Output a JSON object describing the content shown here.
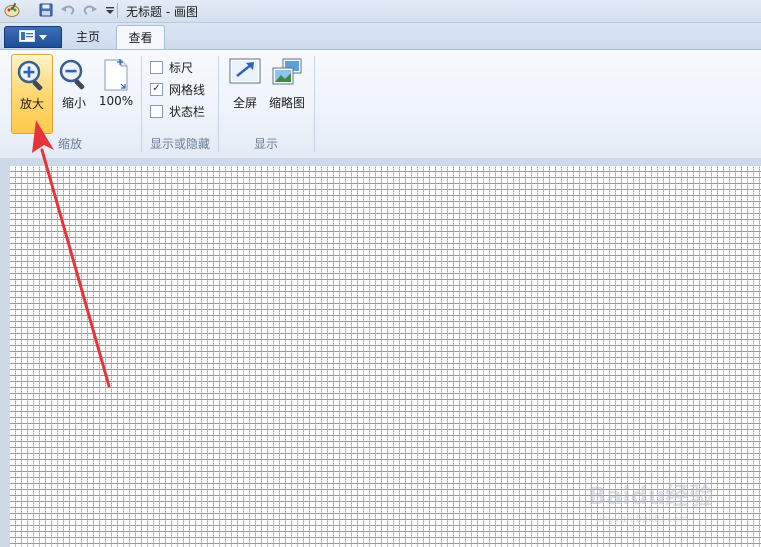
{
  "window": {
    "title": "无标题 - 画图"
  },
  "quick_access": {
    "icons": [
      "paint-app-icon",
      "save-icon",
      "undo-icon",
      "redo-icon",
      "customize-dropdown-icon"
    ]
  },
  "tabs": [
    {
      "label": "主页",
      "active": false
    },
    {
      "label": "查看",
      "active": true
    }
  ],
  "ribbon": {
    "zoom_group": {
      "label": "缩放",
      "zoom_in": "放大",
      "zoom_out": "缩小",
      "zoom_100": "100%"
    },
    "show_hide_group": {
      "label": "显示或隐藏",
      "ruler": {
        "label": "标尺",
        "checked": false
      },
      "gridlines": {
        "label": "网格线",
        "checked": true
      },
      "statusbar": {
        "label": "状态栏",
        "checked": false
      }
    },
    "display_group": {
      "label": "显示",
      "fullscreen": "全屏",
      "thumbnail": "缩略图"
    }
  },
  "colors": {
    "accent_active": "#ffd872",
    "app_menu": "#2a5ca8",
    "arrow": "#e8333a"
  },
  "watermark": {
    "text": "Baidu经验",
    "sub": "jingyan.baidu.com"
  }
}
